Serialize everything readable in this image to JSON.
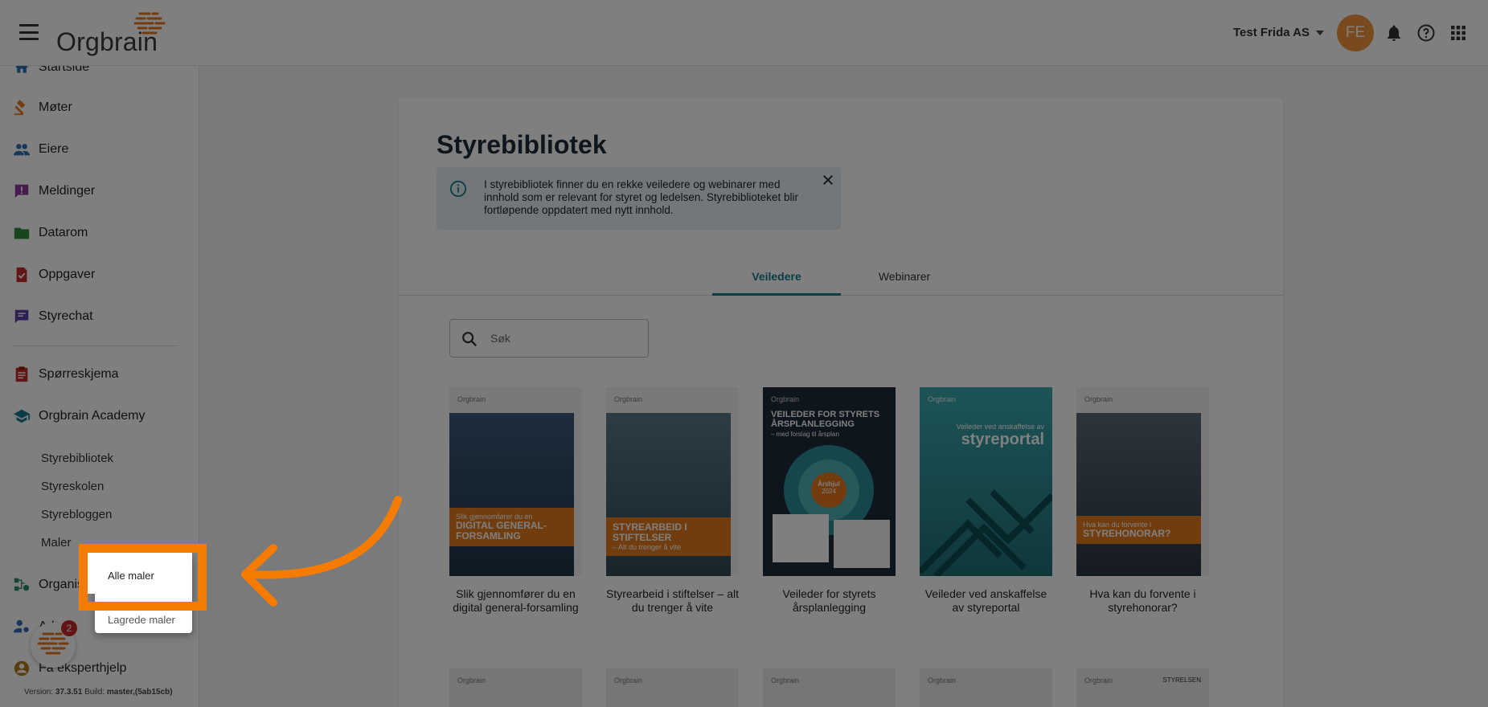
{
  "topbar": {
    "logo": "Orgbrain",
    "company": "Test Frida AS",
    "avatar_initials": "FE"
  },
  "sidebar": {
    "items": [
      {
        "label": "Startside",
        "icon": "home-icon"
      },
      {
        "label": "Møter",
        "icon": "gavel-icon"
      },
      {
        "label": "Eiere",
        "icon": "people-icon"
      },
      {
        "label": "Meldinger",
        "icon": "announcement-icon"
      },
      {
        "label": "Datarom",
        "icon": "folder-icon"
      },
      {
        "label": "Oppgaver",
        "icon": "task-icon"
      },
      {
        "label": "Styrechat",
        "icon": "chat-icon"
      },
      {
        "label": "Spørreskjema",
        "icon": "clipboard-icon"
      },
      {
        "label": "Orgbrain Academy",
        "icon": "school-icon"
      },
      {
        "label": "Organisas",
        "icon": "organization-icon"
      },
      {
        "label": "Ad",
        "icon": "admin-icon"
      },
      {
        "label": "Få eksperthjelp",
        "icon": "expert-help-icon"
      }
    ],
    "academy_sub": [
      "Styrebibliotek",
      "Styreskolen",
      "Styrebloggen",
      "Maler"
    ],
    "version_label": "Version:",
    "version_value": "37.3.51",
    "build_label": "Build:",
    "build_value": "master,(5ab15cb)",
    "chat_badge": "2"
  },
  "main": {
    "title": "Styrebibliotek",
    "info_text": "I styrebibliotek finner du en rekke veiledere og webinarer med innhold som er relevant for styret og ledelsen. Styrebiblioteket blir fortløpende oppdatert med nytt innhold.",
    "tabs": [
      "Veiledere",
      "Webinarer"
    ],
    "search_placeholder": "Søk",
    "books": [
      {
        "title": "Slik gjennomfører du en digital general-forsamling",
        "brand": "Orgbrain",
        "band_small": "Slik gjennomfører du en",
        "band_big": "DIGITAL GENERAL-FORSAMLING"
      },
      {
        "title": "Styrearbeid i stiftelser – alt du trenger å vite",
        "brand": "Orgbrain",
        "band_small": "– Alt du trenger å vite",
        "band_big": "STYREARBEID I STIFTELSER"
      },
      {
        "title": "Veileder for styrets årsplanlegging",
        "brand": "Orgbrain",
        "band_big": "VEILEDER FOR STYRETS ÅRSPLANLEGGING",
        "band_small": "– med forslag til årsplan",
        "wheel_label": "Årshjul",
        "wheel_year": "2024"
      },
      {
        "title": "Veileder ved anskaffelse av styreportal",
        "brand": "Orgbrain",
        "band_small": "Veileder ved anskaffelse av",
        "band_big": "styreportal"
      },
      {
        "title": "Hva kan du forvente i styrehonorar?",
        "brand": "Orgbrain",
        "band_small": "Hva kan du forvente i",
        "band_big": "STYREHONORAR?"
      }
    ],
    "row2_brands": [
      "Orgbrain",
      "Orgbrain",
      "Orgbrain",
      "Orgbrain",
      "Orgbrain"
    ],
    "row2_extra": "STYRELSEN"
  },
  "menu": {
    "items": [
      "Alle maler",
      "Lagrede maler"
    ]
  },
  "colors": {
    "accent": "#157b8c",
    "brand_orange": "#f57c00",
    "avatar": "#f0953a"
  }
}
